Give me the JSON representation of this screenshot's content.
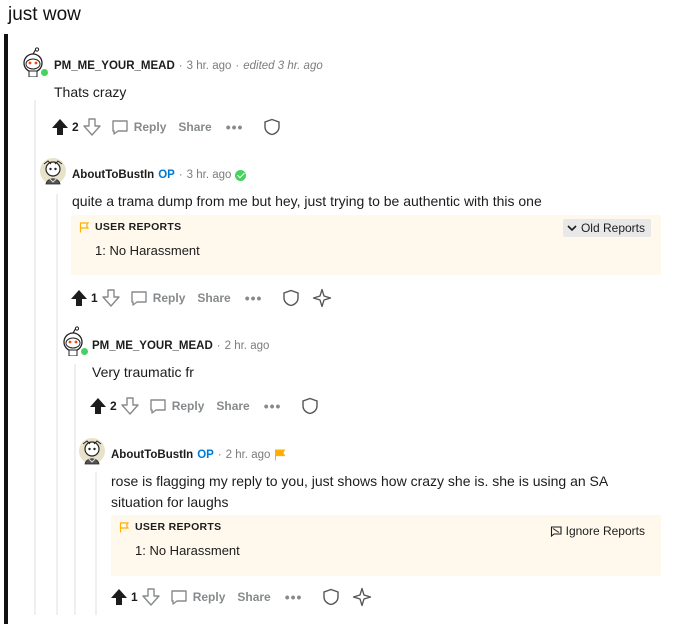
{
  "post": {
    "title": "just wow"
  },
  "actions_text": {
    "reply": "Reply",
    "share": "Share",
    "more": "•••"
  },
  "reports_header": "USER REPORTS",
  "comments": [
    {
      "author": "PM_ME_YOUR_MEAD",
      "time": "3 hr. ago",
      "edited": "edited 3 hr. ago",
      "body": "Thats crazy",
      "votes": "2"
    },
    {
      "author": "AboutToBustIn",
      "op": "OP",
      "time": "3 hr. ago",
      "body": "quite a trama dump from me but hey, just trying to be authentic with this one",
      "votes": "1",
      "reports": {
        "line": "1: No Harassment",
        "button": "Old Reports"
      }
    },
    {
      "author": "PM_ME_YOUR_MEAD",
      "time": "2 hr. ago",
      "body": "Very traumatic fr",
      "votes": "2"
    },
    {
      "author": "AboutToBustIn",
      "op": "OP",
      "time": "2 hr. ago",
      "body_line1": "rose is flagging my reply to you, just shows how crazy she is. she is using an SA",
      "body_line2": "situation for laughs",
      "votes": "1",
      "reports": {
        "line": "1: No Harassment",
        "button": "Ignore Reports"
      }
    }
  ],
  "colors": {
    "online": "#46d160",
    "op": "#0079d3",
    "reports_bg": "#fff9ed",
    "flag": "#ffb000",
    "muted": "#878a8c"
  }
}
